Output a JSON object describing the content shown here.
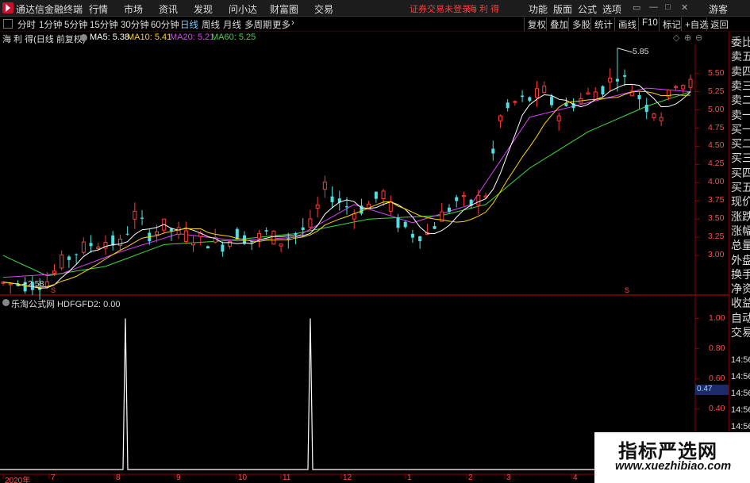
{
  "app": {
    "title": "通达信金融终端"
  },
  "menu": [
    "行情",
    "市场",
    "资讯",
    "发现",
    "问小达",
    "财富圈",
    "交易"
  ],
  "trade_status": "证券交易未登录",
  "stock_name_top": "海 利 得",
  "right_menu": [
    "功能",
    "版面",
    "公式",
    "选项"
  ],
  "guest": "游客",
  "periods": [
    "分时",
    "1分钟",
    "5分钟",
    "15分钟",
    "30分钟",
    "60分钟",
    "日线",
    "周线",
    "月线",
    "多周期",
    "更多"
  ],
  "active_period": "日线",
  "tools": [
    "复权",
    "叠加",
    "多股",
    "统计",
    "画线",
    "F10",
    "标记",
    "+自选",
    "返回"
  ],
  "main_chart": {
    "title": "海 利 得(日线 前复权)",
    "ma": [
      {
        "label": "MA5: 5.38",
        "color": "#ffffff"
      },
      {
        "label": "MA10: 5.41",
        "color": "#ffd400"
      },
      {
        "label": "MA20: 5.21",
        "color": "#e040fb"
      },
      {
        "label": "MA60: 5.25",
        "color": "#3cdc3c"
      }
    ],
    "high_label": "5.85",
    "low_label": "2.58",
    "s_marker": "S"
  },
  "right_panel": {
    "labels": [
      "委比",
      "卖五",
      "卖四",
      "卖三",
      "卖二",
      "卖一",
      "买一",
      "买二",
      "买三",
      "买四",
      "买五",
      "现价",
      "涨跌",
      "涨幅",
      "总量",
      "外盘",
      "换手",
      "净资",
      "收益",
      "自动",
      "交易"
    ],
    "times": [
      "14:56",
      "14:56",
      "14:56",
      "14:56",
      "14:56",
      "14:56",
      "14:56"
    ]
  },
  "indicator": {
    "name": "乐淘公式网 HDFGFD2: 0.00",
    "current": "0.47"
  },
  "chart_data": [
    {
      "type": "candlestick",
      "title": "海 利 得(日线 前复权)",
      "ylim": [
        2.5,
        5.9
      ],
      "y_ticks": [
        "5.50",
        "5.25",
        "5.00",
        "4.75",
        "4.50",
        "4.25",
        "4.00",
        "3.75",
        "3.50",
        "3.25",
        "3.00"
      ],
      "x_ticks": [
        "2020年",
        "7",
        "8",
        "9",
        "10",
        "11",
        "12",
        "1",
        "2",
        "3",
        "4"
      ],
      "annotations": {
        "high": 5.85,
        "low": 2.58
      },
      "close_trend": [
        [
          0,
          2.62
        ],
        [
          2,
          2.6
        ],
        [
          4,
          2.6
        ],
        [
          6,
          2.65
        ],
        [
          8,
          2.9
        ],
        [
          10,
          3.05
        ],
        [
          12,
          3.15
        ],
        [
          14,
          3.2
        ],
        [
          16,
          3.15
        ],
        [
          18,
          3.55
        ],
        [
          20,
          3.3
        ],
        [
          22,
          3.4
        ],
        [
          24,
          3.3
        ],
        [
          26,
          3.25
        ],
        [
          28,
          3.2
        ],
        [
          30,
          3.15
        ],
        [
          32,
          3.3
        ],
        [
          34,
          3.2
        ],
        [
          36,
          3.3
        ],
        [
          38,
          3.2
        ],
        [
          40,
          3.3
        ],
        [
          42,
          3.4
        ],
        [
          44,
          3.9
        ],
        [
          46,
          3.75
        ],
        [
          48,
          3.6
        ],
        [
          50,
          3.7
        ],
        [
          52,
          3.85
        ],
        [
          54,
          3.45
        ],
        [
          56,
          3.3
        ],
        [
          58,
          3.3
        ],
        [
          60,
          3.55
        ],
        [
          62,
          3.75
        ],
        [
          64,
          3.7
        ],
        [
          66,
          3.85
        ],
        [
          68,
          4.9
        ],
        [
          70,
          5.1
        ],
        [
          72,
          5.15
        ],
        [
          74,
          5.25
        ],
        [
          76,
          4.95
        ],
        [
          78,
          5.1
        ],
        [
          80,
          5.2
        ],
        [
          82,
          5.3
        ],
        [
          84,
          5.5
        ],
        [
          86,
          5.3
        ],
        [
          88,
          5.05
        ],
        [
          90,
          4.95
        ],
        [
          92,
          5.4
        ],
        [
          94,
          5.35
        ]
      ],
      "ma20_trend": [
        [
          0,
          2.7
        ],
        [
          8,
          2.75
        ],
        [
          16,
          3.05
        ],
        [
          24,
          3.3
        ],
        [
          32,
          3.2
        ],
        [
          40,
          3.25
        ],
        [
          48,
          3.7
        ],
        [
          56,
          3.45
        ],
        [
          64,
          3.7
        ],
        [
          72,
          4.9
        ],
        [
          80,
          5.1
        ],
        [
          88,
          5.3
        ],
        [
          94,
          5.25
        ]
      ],
      "ma60_trend": [
        [
          0,
          3.0
        ],
        [
          6,
          2.72
        ],
        [
          14,
          2.85
        ],
        [
          22,
          3.15
        ],
        [
          30,
          3.2
        ],
        [
          40,
          3.3
        ],
        [
          50,
          3.5
        ],
        [
          60,
          3.55
        ],
        [
          66,
          3.7
        ],
        [
          72,
          4.2
        ],
        [
          80,
          4.7
        ],
        [
          88,
          5.05
        ],
        [
          94,
          5.25
        ]
      ]
    },
    {
      "type": "line",
      "series": [
        {
          "name": "HDFGFD2",
          "values": [
            0,
            1,
            0,
            1,
            0
          ]
        }
      ],
      "x": [
        "2020年",
        "8",
        "8",
        "11",
        "4"
      ],
      "spikes": [
        {
          "x_tick": "8",
          "value": 1.0
        },
        {
          "x_tick": "11",
          "value": 1.0
        }
      ],
      "ylim": [
        0,
        1.05
      ],
      "y_ticks": [
        "1.00",
        "0.80",
        "0.60",
        "0.40",
        "0.20"
      ]
    }
  ],
  "watermark": {
    "text": "指标严选网",
    "url": "www.xuezhibiao.com"
  },
  "colors": {
    "up": "#ff3b3b",
    "down": "#4ee0e0",
    "axis": "#8b0000",
    "text_red": "#ff4d4d"
  }
}
